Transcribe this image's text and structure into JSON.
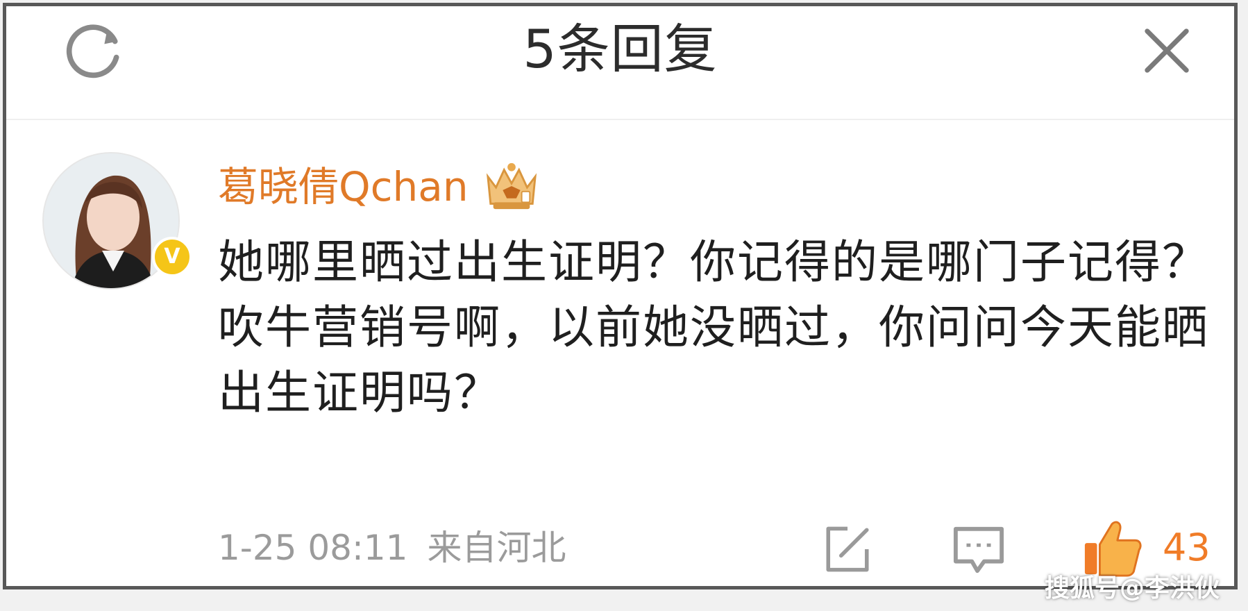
{
  "header": {
    "title": "5条回复",
    "refresh_icon": "refresh-icon",
    "close_icon": "close-icon"
  },
  "comment": {
    "username": "葛晓倩Qchan",
    "verified_badge_label": "V",
    "text": "她哪里晒过出生证明？你记得的是哪门子记得？吹牛营销号啊，以前她没晒过，你问问今天能晒出生证明吗？",
    "timestamp": "1-25 08:11",
    "location": "来自河北",
    "like_count": "43"
  },
  "watermark": "搜狐号@李洪伙",
  "colors": {
    "username": "#e07a28",
    "like": "#f07c28",
    "badge": "#f5c518",
    "meta": "#9b9b9b"
  }
}
